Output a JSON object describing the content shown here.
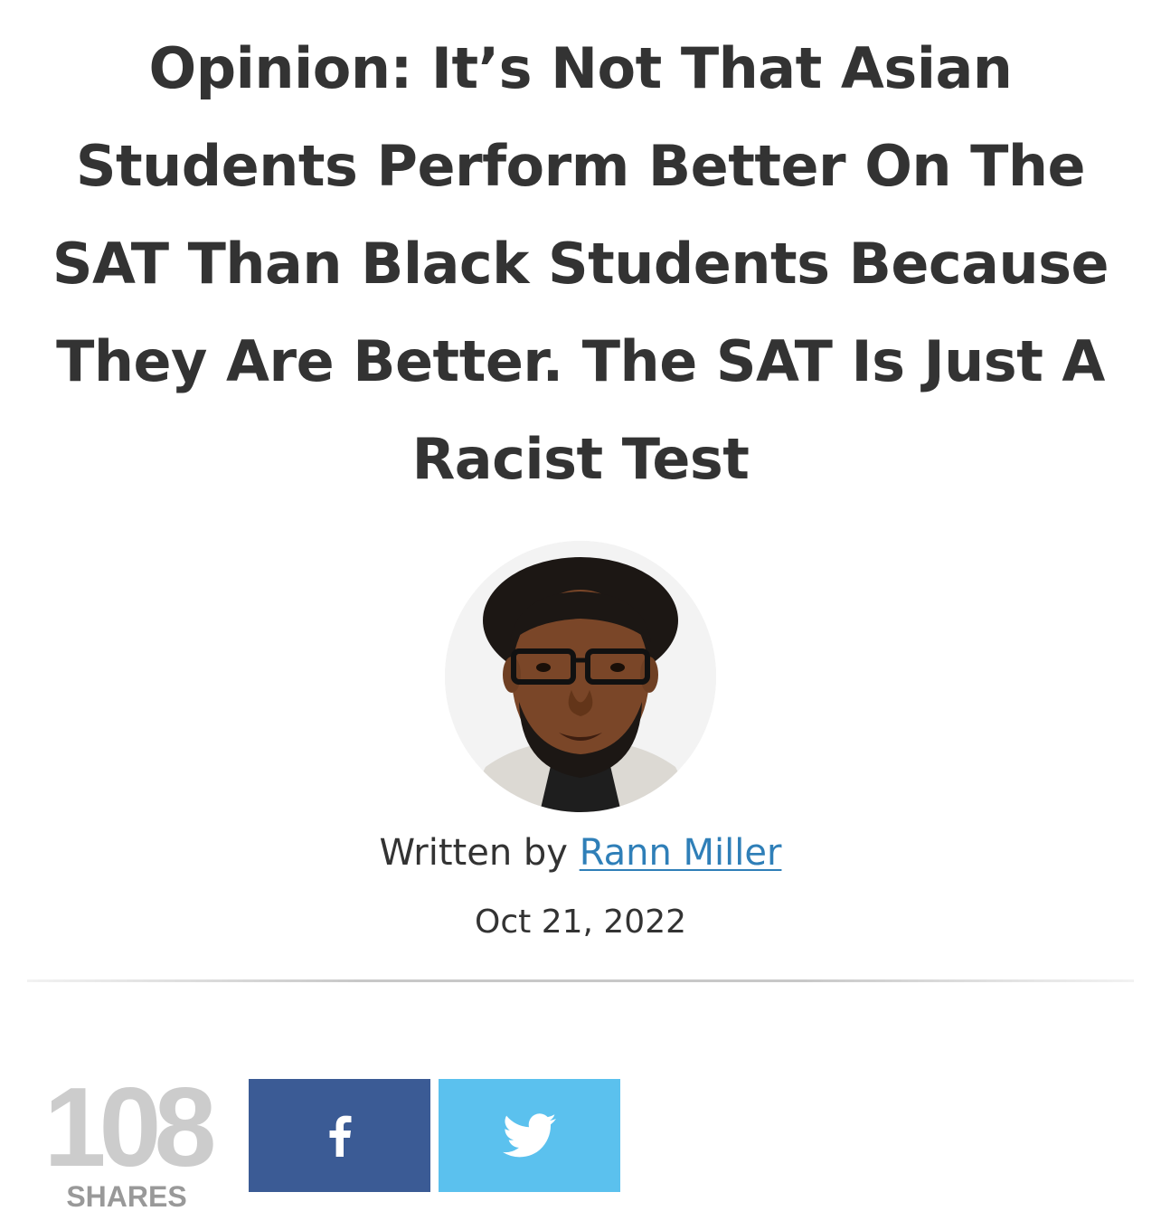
{
  "article": {
    "title": "Opinion: It’s Not That Asian Students Perform Better On The SAT Than Black Students Because They Are Better. The SAT Is Just A Racist Test",
    "byline_prefix": "Written by",
    "author": "Rann Miller",
    "date": "Oct 21, 2022"
  },
  "share": {
    "count": "108",
    "label": "SHARES",
    "buttons": [
      {
        "network": "facebook",
        "icon": "facebook-icon",
        "color": "#3b5b95"
      },
      {
        "network": "twitter",
        "icon": "twitter-icon",
        "color": "#5bc1ee"
      }
    ]
  },
  "colors": {
    "text": "#333333",
    "link": "#2f7fb8",
    "share_count": "#cccccc",
    "share_label": "#999999"
  }
}
